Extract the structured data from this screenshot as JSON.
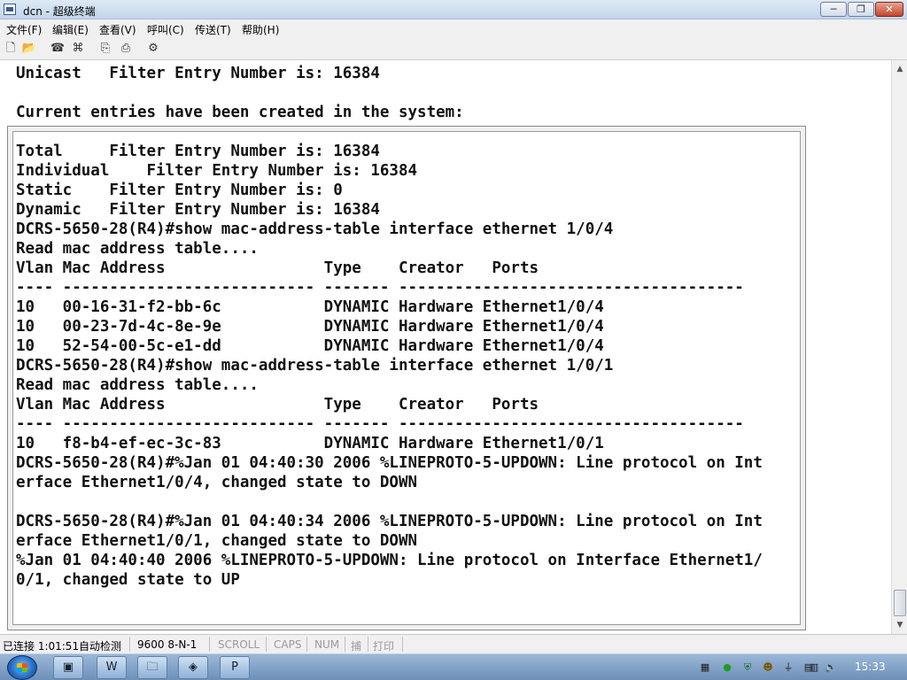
{
  "window": {
    "title": "dcn - 超级终端",
    "btn_min": "─",
    "btn_max": "❐",
    "btn_close": "✕"
  },
  "menu": [
    "文件(F)",
    "编辑(E)",
    "查看(V)",
    "呼叫(C)",
    "传送(T)",
    "帮助(H)"
  ],
  "toolbar_icons": [
    {
      "name": "new-file-icon",
      "glyph": "🗋"
    },
    {
      "name": "open-folder-icon",
      "glyph": "📂"
    },
    {
      "name": "phone-icon",
      "glyph": "☎"
    },
    {
      "name": "disconnect-icon",
      "glyph": "⌘"
    },
    {
      "name": "send-icon",
      "glyph": "⎘"
    },
    {
      "name": "receive-icon",
      "glyph": "⎙"
    },
    {
      "name": "properties-icon",
      "glyph": "⚙"
    }
  ],
  "terminal": {
    "lines": [
      "Unicast   Filter Entry Number is: 16384",
      "",
      "Current entries have been created in the system:",
      "",
      "Total     Filter Entry Number is: 16384",
      "Individual    Filter Entry Number is: 16384",
      "Static    Filter Entry Number is: 0",
      "Dynamic   Filter Entry Number is: 16384",
      "DCRS-5650-28(R4)#show mac-address-table interface ethernet 1/0/4",
      "Read mac address table....",
      "Vlan Mac Address                 Type    Creator   Ports",
      "---- --------------------------- ------- -------------------------------------",
      "10   00-16-31-f2-bb-6c           DYNAMIC Hardware Ethernet1/0/4",
      "10   00-23-7d-4c-8e-9e           DYNAMIC Hardware Ethernet1/0/4",
      "10   52-54-00-5c-e1-dd           DYNAMIC Hardware Ethernet1/0/4",
      "DCRS-5650-28(R4)#show mac-address-table interface ethernet 1/0/1",
      "Read mac address table....",
      "Vlan Mac Address                 Type    Creator   Ports",
      "---- --------------------------- ------- -------------------------------------",
      "10   f8-b4-ef-ec-3c-83           DYNAMIC Hardware Ethernet1/0/1",
      "DCRS-5650-28(R4)#%Jan 01 04:40:30 2006 %LINEPROTO-5-UPDOWN: Line protocol on Int",
      "erface Ethernet1/0/4, changed state to DOWN",
      "",
      "DCRS-5650-28(R4)#%Jan 01 04:40:34 2006 %LINEPROTO-5-UPDOWN: Line protocol on Int",
      "erface Ethernet1/0/1, changed state to DOWN",
      "%Jan 01 04:40:40 2006 %LINEPROTO-5-UPDOWN: Line protocol on Interface Ethernet1/",
      "0/1, changed state to UP"
    ]
  },
  "scrollbar": {
    "up": "▲",
    "down": "▼"
  },
  "status": {
    "connection": "已连接 1:01:51",
    "detect": "自动检测",
    "baud": "9600 8-N-1",
    "scroll": "SCROLL",
    "caps": "CAPS",
    "num": "NUM",
    "capture": "捕",
    "print": "打印"
  },
  "taskbar": {
    "apps": [
      {
        "name": "taskbar-explorer-icon",
        "glyph": "▣"
      },
      {
        "name": "taskbar-word-icon",
        "glyph": "W"
      },
      {
        "name": "taskbar-folder-icon",
        "glyph": "🗀"
      },
      {
        "name": "taskbar-app-icon",
        "glyph": "◈"
      },
      {
        "name": "taskbar-powerpoint-icon",
        "glyph": "P"
      }
    ],
    "tray": [
      {
        "name": "tray-media-icon",
        "glyph": "▦"
      },
      {
        "name": "tray-green-icon",
        "glyph": "●"
      },
      {
        "name": "tray-shield-icon",
        "glyph": "⛨"
      },
      {
        "name": "tray-people-icon",
        "glyph": "☻"
      },
      {
        "name": "tray-usb-icon",
        "glyph": "⏚"
      },
      {
        "name": "tray-clipboard-icon",
        "glyph": "▤"
      },
      {
        "name": "tray-network-icon",
        "glyph": "▥"
      },
      {
        "name": "tray-volume-icon",
        "glyph": "🔈"
      }
    ],
    "clock": "15:33"
  }
}
